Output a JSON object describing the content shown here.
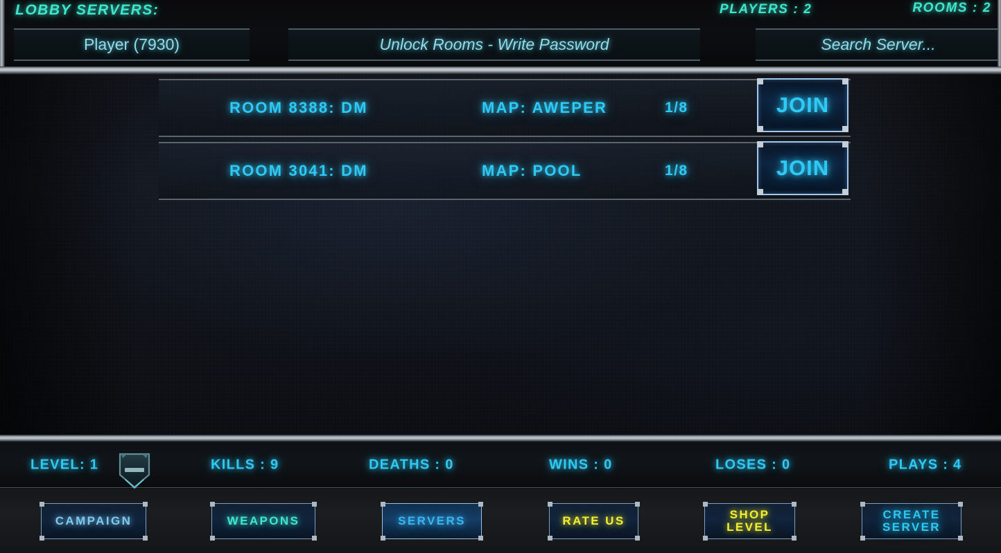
{
  "header": {
    "lobby_title": "LOBBY SERVERS:",
    "players_label": "PLAYERS : 2",
    "rooms_label": "ROOMS : 2",
    "player_field_value": "Player (7930)",
    "password_field_placeholder": "Unlock Rooms - Write Password",
    "search_field_placeholder": "Search  Server..."
  },
  "rooms": [
    {
      "name": "ROOM 8388: DM",
      "map": "MAP: AWEPER",
      "slots": "1/8",
      "join_label": "JOIN"
    },
    {
      "name": "ROOM 3041: DM",
      "map": "MAP: POOL",
      "slots": "1/8",
      "join_label": "JOIN"
    }
  ],
  "stats": {
    "level": "LEVEL: 1",
    "kills": "KILLS : 9",
    "deaths": "DEATHS : 0",
    "wins": "WINS : 0",
    "loses": "LOSES : 0",
    "plays": "PLAYS : 4"
  },
  "nav": {
    "campaign": "CAMPAIGN",
    "weapons": "WEAPONS",
    "servers": "SERVERS",
    "rate_us": "RATE US",
    "shop_level": "SHOP\nLEVEL",
    "create_server": "CREATE\nSERVER"
  },
  "colors": {
    "teal": "#3fe6cd",
    "cyan": "#2ec9f5",
    "light_blue": "#7fc9f0",
    "yellow": "#f2f02e",
    "panel_bg": "#101318",
    "header_bg": "#0a0b0e",
    "divider_silver": "#c6cdd3"
  }
}
